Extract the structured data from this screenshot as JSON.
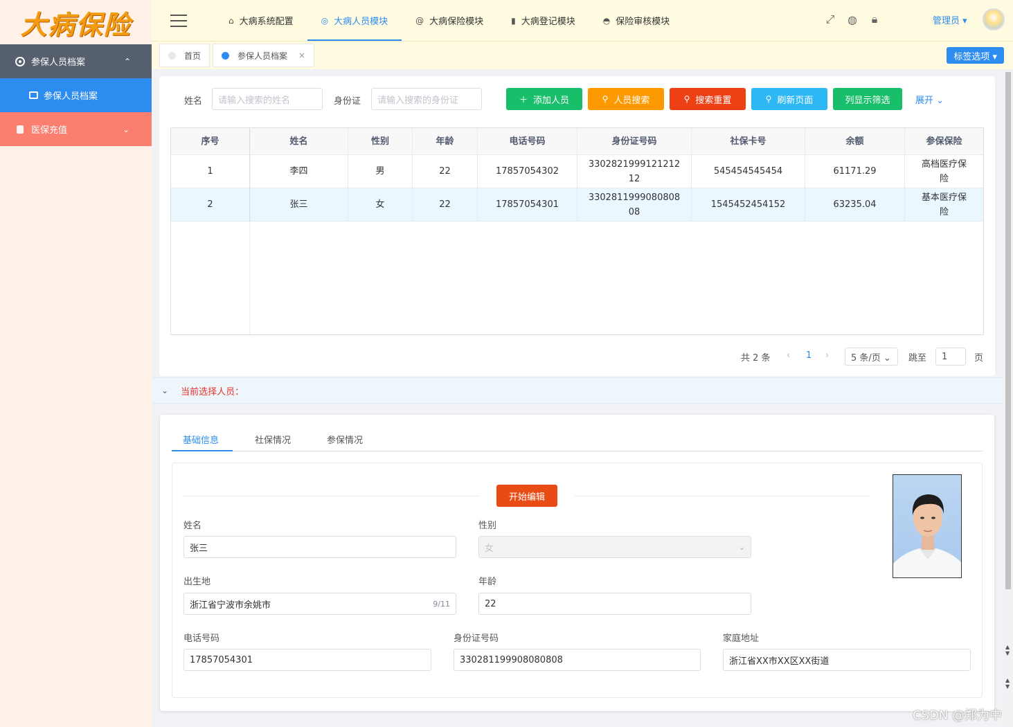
{
  "app": {
    "logo": "大病保险"
  },
  "sidebar": {
    "group1": {
      "label": "参保人员档案",
      "arrow": "⌃"
    },
    "sub1": {
      "label": "参保人员档案"
    },
    "group2": {
      "label": "医保充值",
      "arrow": "⌄"
    }
  },
  "topnav": {
    "items": [
      {
        "label": "大病系统配置",
        "icon": "⌂"
      },
      {
        "label": "大病人员模块",
        "icon": "◎"
      },
      {
        "label": "大病保险模块",
        "icon": "@"
      },
      {
        "label": "大病登记模块",
        "icon": "▮"
      },
      {
        "label": "保险审核模块",
        "icon": "◓"
      }
    ],
    "user": "管理员 ▾"
  },
  "tags": {
    "home": "首页",
    "current": "参保人员档案",
    "close": "×",
    "options": "标签选项 ▾"
  },
  "search": {
    "name_label": "姓名",
    "name_placeholder": "请输入搜索的姓名",
    "id_label": "身份证",
    "id_placeholder": "请输入搜索的身份证",
    "btn_add": "添加人员",
    "btn_search": "人员搜索",
    "btn_reset": "搜索重置",
    "btn_refresh": "刷新页面",
    "btn_filter": "列显示筛选",
    "expand": "展开 ⌄",
    "colors": {
      "add": "#19be6b",
      "search": "#ff9900",
      "reset": "#ed4014",
      "refresh": "#2db7f5",
      "filter": "#19be6b"
    }
  },
  "table": {
    "headers": [
      "序号",
      "姓名",
      "性别",
      "年龄",
      "电话号码",
      "身份证号码",
      "社保卡号",
      "余额",
      "参保保险"
    ],
    "rows": [
      [
        "1",
        "李四",
        "男",
        "22",
        "17857054302",
        "330282199912121212",
        "545454545454",
        "61171.29",
        "高档医疗保险"
      ],
      [
        "2",
        "张三",
        "女",
        "22",
        "17857054301",
        "330281199908080808",
        "1545452454152",
        "63235.04",
        "基本医疗保险"
      ]
    ],
    "rows_display": [
      [
        "1",
        "李四",
        "男",
        "22",
        "17857054302",
        "3302821999121212\n12",
        "545454545454",
        "61171.29",
        "高档医疗保\n险"
      ],
      [
        "2",
        "张三",
        "女",
        "22",
        "17857054301",
        "3302811999080808\n08",
        "1545452454152",
        "63235.04",
        "基本医疗保\n险"
      ]
    ]
  },
  "pager": {
    "total": "共 2 条",
    "prev": "‹",
    "page": "1",
    "next": "›",
    "size": "5 条/页 ⌄",
    "jump": "跳至",
    "jump_value": "1",
    "page_unit": "页"
  },
  "detail": {
    "header": "当前选择人员：",
    "chevron": "⌄"
  },
  "tabs": [
    "基础信息",
    "社保情况",
    "参保情况"
  ],
  "form": {
    "edit_btn": "开始编辑",
    "name_label": "姓名",
    "name": "张三",
    "gender_label": "性别",
    "gender": "女",
    "birthplace_label": "出生地",
    "birthplace": "浙江省宁波市余姚市",
    "birthplace_count": "9/11",
    "age_label": "年龄",
    "age": "22",
    "phone_label": "电话号码",
    "phone": "17857054301",
    "idcard_label": "身份证号码",
    "idcard": "330281199908080808",
    "address_label": "家庭地址",
    "address": "浙江省XX市XX区XX街道"
  },
  "watermark": "CSDN @郑为中"
}
